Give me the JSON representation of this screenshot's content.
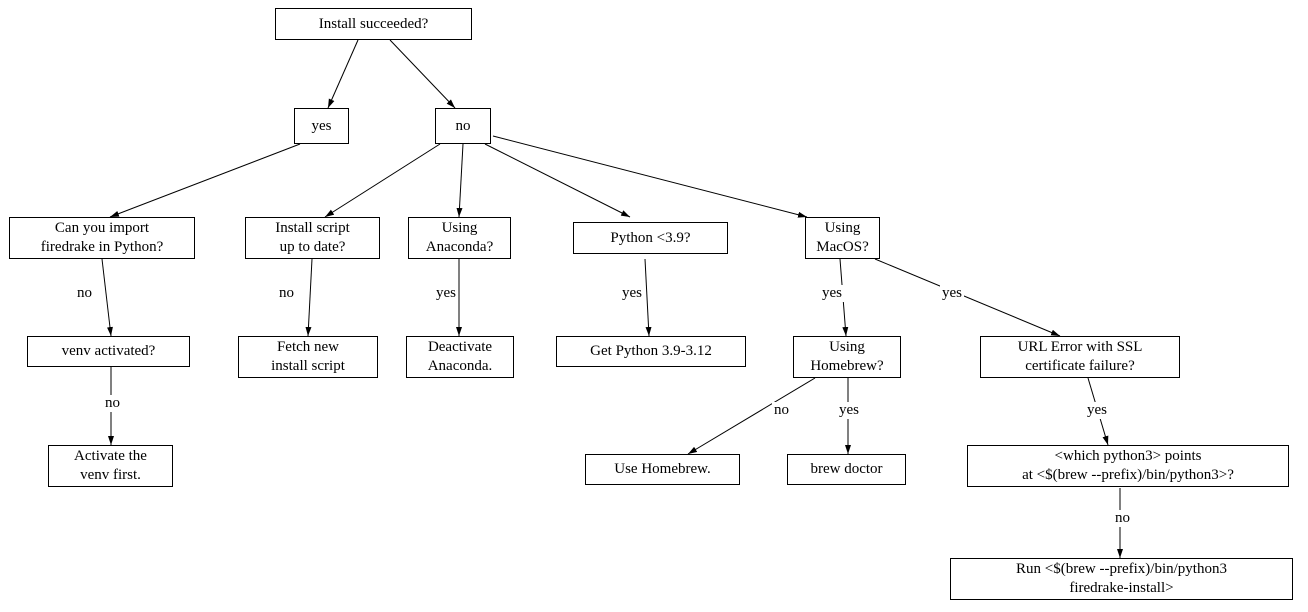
{
  "chart_data": {
    "type": "flowchart",
    "nodes": [
      {
        "id": "root",
        "label": "Install succeeded?"
      },
      {
        "id": "yes1",
        "label": "yes"
      },
      {
        "id": "no1",
        "label": "no"
      },
      {
        "id": "import",
        "label": "Can you import\nfiredrake in Python?"
      },
      {
        "id": "script",
        "label": "Install script\nup to date?"
      },
      {
        "id": "anaconda",
        "label": "Using\nAnaconda?"
      },
      {
        "id": "pyver",
        "label": "Python <3.9?"
      },
      {
        "id": "macos",
        "label": "Using\nMacOS?"
      },
      {
        "id": "venv",
        "label": "venv activated?"
      },
      {
        "id": "fetch",
        "label": "Fetch new\ninstall script"
      },
      {
        "id": "deact",
        "label": "Deactivate\nAnaconda."
      },
      {
        "id": "getpy",
        "label": "Get Python 3.9-3.12"
      },
      {
        "id": "homebrew",
        "label": "Using\nHomebrew?"
      },
      {
        "id": "ssl",
        "label": "URL Error with SSL\ncertificate failure?"
      },
      {
        "id": "activate",
        "label": "Activate the\nvenv first."
      },
      {
        "id": "usehb",
        "label": "Use Homebrew."
      },
      {
        "id": "brewdoc",
        "label": "brew doctor"
      },
      {
        "id": "which",
        "label": "<which python3> points\nat <$(brew --prefix)/bin/python3>?"
      },
      {
        "id": "run",
        "label": "Run <$(brew --prefix)/bin/python3\nfiredrake-install>"
      }
    ],
    "edges": [
      {
        "from": "root",
        "to": "yes1"
      },
      {
        "from": "root",
        "to": "no1"
      },
      {
        "from": "yes1",
        "to": "import"
      },
      {
        "from": "no1",
        "to": "script"
      },
      {
        "from": "no1",
        "to": "anaconda"
      },
      {
        "from": "no1",
        "to": "pyver"
      },
      {
        "from": "no1",
        "to": "macos"
      },
      {
        "from": "import",
        "to": "venv",
        "label": "no"
      },
      {
        "from": "script",
        "to": "fetch",
        "label": "no"
      },
      {
        "from": "anaconda",
        "to": "deact",
        "label": "yes"
      },
      {
        "from": "pyver",
        "to": "getpy",
        "label": "yes"
      },
      {
        "from": "macos",
        "to": "homebrew",
        "label": "yes"
      },
      {
        "from": "macos",
        "to": "ssl",
        "label": "yes"
      },
      {
        "from": "venv",
        "to": "activate",
        "label": "no"
      },
      {
        "from": "homebrew",
        "to": "usehb",
        "label": "no"
      },
      {
        "from": "homebrew",
        "to": "brewdoc",
        "label": "yes"
      },
      {
        "from": "ssl",
        "to": "which",
        "label": "yes"
      },
      {
        "from": "which",
        "to": "run",
        "label": "no"
      }
    ]
  },
  "nodes": {
    "root": "Install succeeded?",
    "yes1": "yes",
    "no1": "no",
    "import": "Can you import\nfiredrake in Python?",
    "script": "Install script\nup to date?",
    "anaconda": "Using\nAnaconda?",
    "pyver": "Python <3.9?",
    "macos": "Using\nMacOS?",
    "venv": "venv activated?",
    "fetch": "Fetch new\ninstall script",
    "deact": "Deactivate\nAnaconda.",
    "getpy": "Get Python 3.9-3.12",
    "homebrew": "Using\nHomebrew?",
    "ssl": "URL Error with SSL\ncertificate failure?",
    "activate": "Activate the\nvenv first.",
    "usehb": "Use Homebrew.",
    "brewdoc": "brew doctor",
    "which": "<which python3> points\nat <$(brew --prefix)/bin/python3>?",
    "run": "Run <$(brew --prefix)/bin/python3\nfiredrake-install>"
  },
  "labels": {
    "no": "no",
    "yes": "yes"
  }
}
